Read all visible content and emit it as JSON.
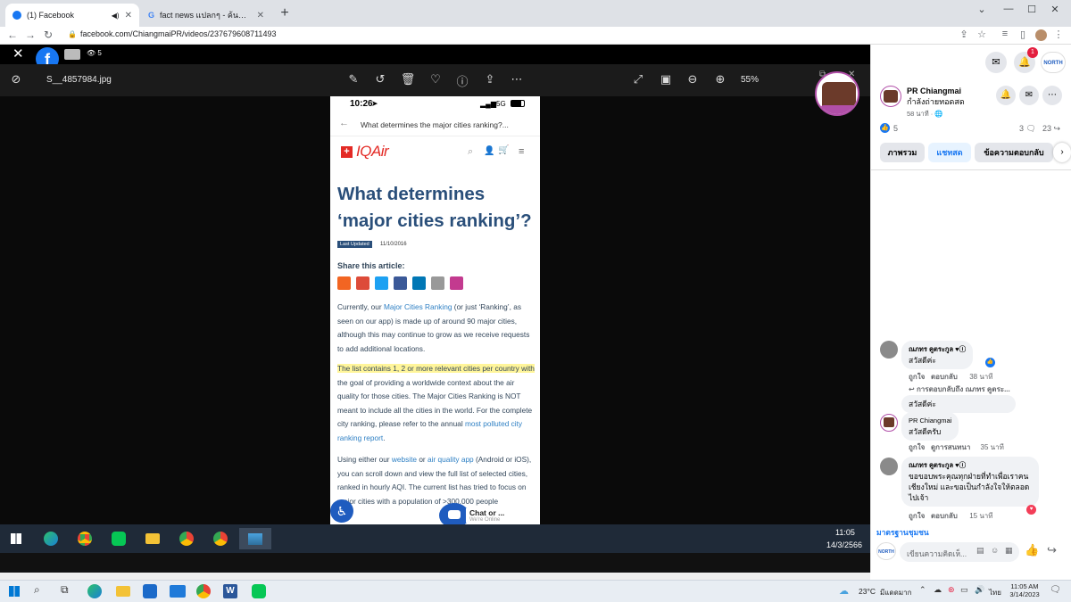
{
  "browser": {
    "tabs": [
      {
        "title": "(1) Facebook",
        "active": true
      },
      {
        "title": "fact news แปลกๆ - ค้นหาด้วย Google",
        "active": false
      }
    ],
    "url": "facebook.com/ChiangmaiPR/videos/237679608711493"
  },
  "viewer": {
    "view_count": "5",
    "filename": "S__4857984.jpg",
    "zoom": "55%",
    "phone": {
      "time": "10:26",
      "signal": "5G",
      "page_title": "What determines the major cities ranking?...",
      "brand": "IQAir",
      "heading_line1": "What determines",
      "heading_line2": "‘major cities ranking’?",
      "badge": "Last Updated",
      "date": "11/10/2016",
      "share_label": "Share this article:",
      "p1_a": "Currently, our ",
      "p1_link": "Major Cities Ranking",
      "p1_b": " (or just ‘Ranking’, as seen on our app) is made up of around 90 major cities, although this may continue to grow as we receive requests to add additional locations.",
      "p2_hl": "The list contains 1, 2 or more relevant cities per country with",
      "p2_b": " the goal of providing a worldwide context about the air quality for those cities. The Major Cities Ranking is NOT meant to include all the cities in the world. For the complete city ranking, please refer to the annual ",
      "p2_link": "most polluted city ranking report",
      "p2_c": ".",
      "p3_a": "Using either our ",
      "p3_link1": "website",
      "p3_b": " or ",
      "p3_link2": "air quality app",
      "p3_c": " (Android or iOS), you can scroll down and view the full list of selected cities, ranked in hourly AQI. The current list has tried to focus on major cities with a population of >300,000 people",
      "chat_label": "Chat or ...",
      "chat_sub": "We're Online"
    },
    "inner_clock": {
      "time": "11:05",
      "date": "14/3/2566"
    }
  },
  "panel": {
    "page_name": "PR Chiangmai",
    "status_suffix": " กำลังถ่ายทอดสด",
    "time_ago": "58 นาที",
    "reactions": "5",
    "comments_count": "3",
    "shares_count": "23",
    "tabs": [
      "ภาพรวม",
      "แชทสด",
      "ข้อความตอบกลับ"
    ],
    "notif_badge": "1",
    "comments": [
      {
        "name": "ณภทร คูตระกูล",
        "text": "สวัสดีค่ะ",
        "like": "ถูกใจ",
        "reply": "ตอบกลับ",
        "time": "38 นาที",
        "reply_hint": "การตอบกลับถึง ณภทร คูตระ..."
      },
      {
        "name": "",
        "text": "สวัสดีค่ะ"
      },
      {
        "name": "PR Chiangmai",
        "text": "สวัสดีครับ",
        "like": "ถูกใจ",
        "reply": "ดูการสนทนา",
        "time": "35 นาที"
      },
      {
        "name": "ณภทร คูตระกูล",
        "text": "ขอขอบพระคุณทุกฝ่ายที่ทำเพื่อเราคนเชียงใหม่ และขอเป็นกำลังใจให้ตลอดไปเจ้า",
        "like": "ถูกใจ",
        "reply": "ตอบกลับ",
        "time": "15 นาที"
      }
    ],
    "standard_link": "มาตรฐานชุมชน",
    "comment_placeholder": "เขียนความคิดเห็..."
  },
  "taskbar": {
    "temperature": "23°C",
    "weather": "มีแดดมาก",
    "lang": "ไทย",
    "time": "11:05 AM",
    "date": "3/14/2023"
  },
  "colors": {
    "fb_blue": "#1877f2",
    "viewer_bg": "#0a0a0a",
    "accent_red": "#e41e3f"
  }
}
